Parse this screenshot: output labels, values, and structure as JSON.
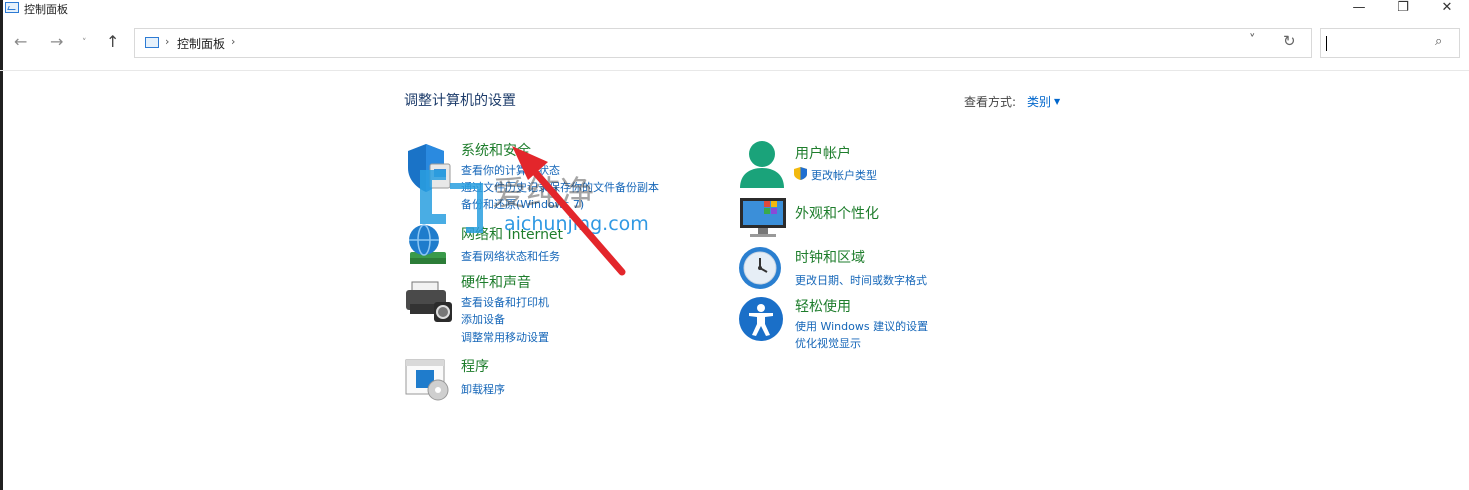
{
  "window": {
    "title": "控制面板",
    "controls": {
      "minimize": "—",
      "maximize": "❐",
      "close": "✕"
    }
  },
  "nav": {
    "back": "←",
    "forward": "→",
    "recent": "˅",
    "up": "↑",
    "address": {
      "path_item": "控制面板",
      "separator": "›"
    },
    "dropdown": "˅",
    "refresh": "↻",
    "search": {
      "value": "",
      "placeholder": "",
      "icon": "search-icon"
    }
  },
  "header": {
    "title": "调整计算机的设置",
    "view_label": "查看方式:",
    "view_value": "类别"
  },
  "categories_left": [
    {
      "title": "系统和安全",
      "icon": "shield-icon",
      "links": [
        "查看你的计算机状态",
        "通过文件历史记录保存你的文件备份副本",
        "备份和还原(Windows 7)"
      ]
    },
    {
      "title": "网络和 Internet",
      "icon": "network-globe-icon",
      "links": [
        "查看网络状态和任务"
      ]
    },
    {
      "title": "硬件和声音",
      "icon": "printer-icon",
      "links": [
        "查看设备和打印机",
        "添加设备",
        "调整常用移动设置"
      ]
    },
    {
      "title": "程序",
      "icon": "programs-icon",
      "links": [
        "卸载程序"
      ]
    }
  ],
  "categories_right": [
    {
      "title": "用户帐户",
      "icon": "user-icon",
      "links": [
        "更改帐户类型"
      ],
      "link_icon": "uac-shield-icon"
    },
    {
      "title": "外观和个性化",
      "icon": "monitor-icon",
      "links": []
    },
    {
      "title": "时钟和区域",
      "icon": "clock-globe-icon",
      "links": [
        "更改日期、时间或数字格式"
      ]
    },
    {
      "title": "轻松使用",
      "icon": "accessibility-icon",
      "links": [
        "使用 Windows 建议的设置",
        "优化视觉显示"
      ]
    }
  ],
  "watermark": {
    "text": "爱纯净",
    "url": "aichunjing.com"
  },
  "colors": {
    "category_title": "#1e7d2c",
    "link": "#1566b8",
    "page_title": "#1e3d6b",
    "arrow": "#e3262b",
    "accent": "#0078d4"
  }
}
